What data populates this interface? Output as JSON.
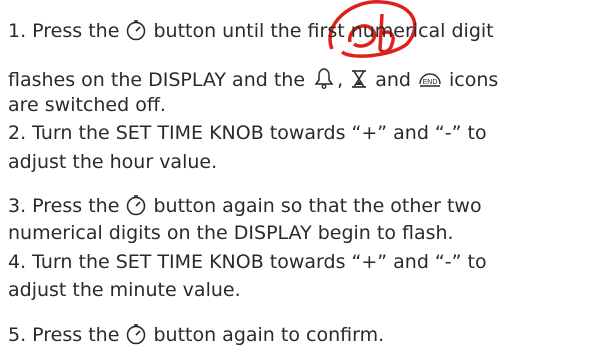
{
  "document": {
    "partial_top_line": "  ...  ...  ...  ...  ...  ...  ...",
    "step1_part1": "1. Press the ",
    "step1_part2": " button until the first numerical digit",
    "step1_line2_part1": "flashes on the DISPLAY and the ",
    "step1_line2_sep1": ", ",
    "step1_line2_part2": " and ",
    "step1_line2_part3": " icons",
    "step1_line3": "are switched off.",
    "step2_line1": "2. Turn the SET TIME KNOB towards “+” and “-” to",
    "step2_line2": "adjust the hour value.",
    "step3_part1": "3. Press the ",
    "step3_part2": " button again so that the other two",
    "step3_line2": "numerical digits on the DISPLAY begin to flash.",
    "step4_line1": "4. Turn the SET TIME KNOB towards “+” and “-” to",
    "step4_line2": "adjust the minute value.",
    "step5_part1": "5. Press the ",
    "step5_part2": " button again to confirm.",
    "end_icon_text": "END"
  },
  "icons": {
    "timer_button": "stopwatch-icon",
    "bell": "bell-icon",
    "hourglass": "hourglass-icon",
    "end": "end-icon",
    "watermark": "red-watermark"
  },
  "colors": {
    "text": "#2a2a2a",
    "watermark": "#e0201c"
  }
}
